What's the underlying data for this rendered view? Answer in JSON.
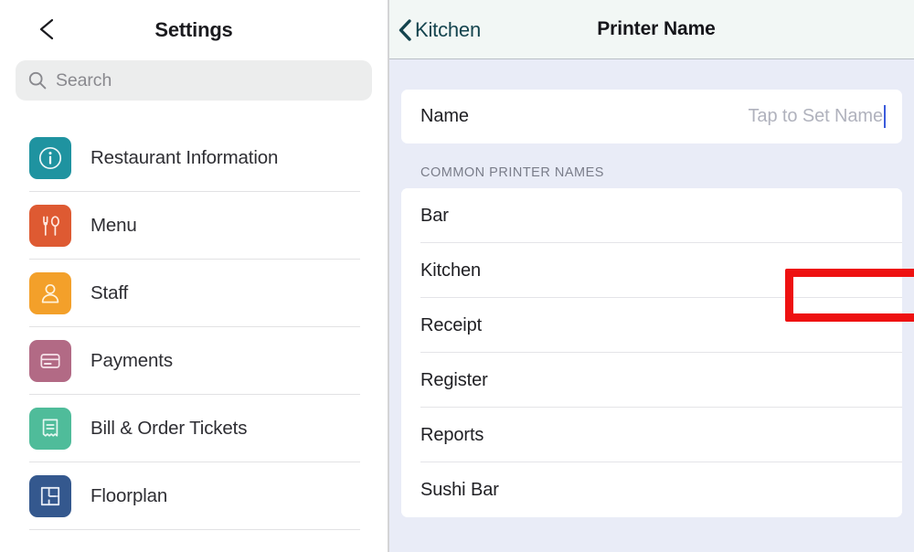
{
  "sidebar": {
    "back_icon": "chevron-left-icon",
    "title": "Settings",
    "search": {
      "icon": "search-icon",
      "placeholder": "Search"
    },
    "items": [
      {
        "label": "Restaurant Information",
        "icon": "info-circle-icon",
        "color": "#1f93a0"
      },
      {
        "label": "Menu",
        "icon": "fork-spoon-icon",
        "color": "#de5a32"
      },
      {
        "label": "Staff",
        "icon": "person-icon",
        "color": "#f3a02a"
      },
      {
        "label": "Payments",
        "icon": "credit-card-icon",
        "color": "#b26a85"
      },
      {
        "label": "Bill & Order Tickets",
        "icon": "receipt-icon",
        "color": "#4fbc9a"
      },
      {
        "label": "Floorplan",
        "icon": "floorplan-icon",
        "color": "#34588e"
      }
    ]
  },
  "detail": {
    "back_icon": "chevron-left-icon",
    "back_label": "Kitchen",
    "title": "Printer Name",
    "name_row": {
      "label": "Name",
      "value": "",
      "placeholder": "Tap to Set Name"
    },
    "section_header": "COMMON PRINTER NAMES",
    "printer_names": [
      "Bar",
      "Kitchen",
      "Receipt",
      "Register",
      "Reports",
      "Sushi Bar"
    ]
  },
  "annotations": {
    "arrow": {
      "name": "red-arrow-annotation",
      "color": "#ee1111",
      "points_to": "Tap to Set Name"
    },
    "highlight_box": {
      "name": "red-highlight-box-annotation",
      "color": "#ee1111",
      "around": "Kitchen"
    }
  },
  "colors": {
    "accent_blue": "#3b5bdb",
    "annotation_red": "#ee1111",
    "detail_bg": "#e9ecf7",
    "header_bg": "#f2f7f5",
    "back_link": "#14444e"
  }
}
